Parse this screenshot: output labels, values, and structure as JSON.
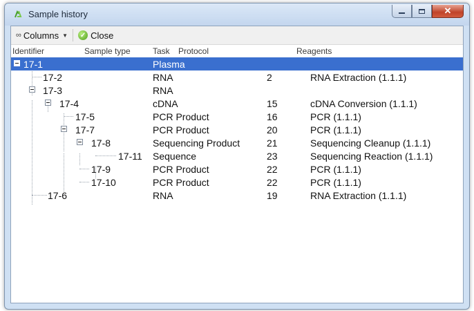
{
  "window": {
    "title": "Sample history",
    "icons": {
      "app": "recycle-arrows-icon",
      "minimize": "minimize-icon",
      "maximize": "maximize-icon",
      "close": "close-icon"
    }
  },
  "toolbar": {
    "columns_label": "Columns",
    "close_label": "Close",
    "icons": {
      "columns": "glasses-icon",
      "close": "checkmark-circle-icon"
    }
  },
  "columns": [
    "Identifier",
    "Sample type",
    "Task",
    "Protocol",
    "Reagents"
  ],
  "rows": [
    {
      "id": "17-1",
      "type": "Plasma",
      "task": "",
      "protocol": ""
    },
    {
      "id": "17-2",
      "type": "RNA",
      "task": "2",
      "protocol": "RNA Extraction (1.1.1)"
    },
    {
      "id": "17-3",
      "type": "RNA",
      "task": "",
      "protocol": ""
    },
    {
      "id": "17-4",
      "type": "cDNA",
      "task": "15",
      "protocol": "cDNA Conversion (1.1.1)"
    },
    {
      "id": "17-5",
      "type": "PCR Product",
      "task": "16",
      "protocol": "PCR (1.1.1)"
    },
    {
      "id": "17-7",
      "type": "PCR Product",
      "task": "20",
      "protocol": "PCR (1.1.1)"
    },
    {
      "id": "17-8",
      "type": "Sequencing Product",
      "task": "21",
      "protocol": "Sequencing Cleanup (1.1.1)"
    },
    {
      "id": "17-11",
      "type": "Sequence",
      "task": "23",
      "protocol": "Sequencing Reaction (1.1.1)"
    },
    {
      "id": "17-9",
      "type": "PCR Product",
      "task": "22",
      "protocol": "PCR (1.1.1)"
    },
    {
      "id": "17-10",
      "type": "PCR Product",
      "task": "22",
      "protocol": "PCR (1.1.1)"
    },
    {
      "id": "17-6",
      "type": "RNA",
      "task": "19",
      "protocol": "RNA Extraction (1.1.1)"
    }
  ],
  "selection": {
    "selected_row": "17-1",
    "highlight_color": "#3a6fcf"
  }
}
